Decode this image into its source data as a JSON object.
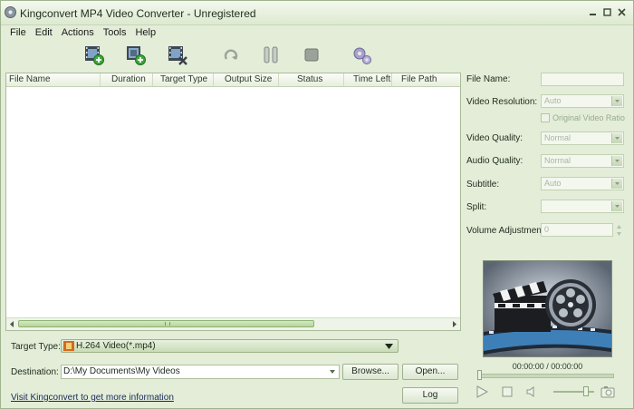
{
  "window": {
    "title": "Kingconvert MP4 Video Converter - Unregistered"
  },
  "menu": [
    {
      "id": "file",
      "label": "File"
    },
    {
      "id": "edit",
      "label": "Edit"
    },
    {
      "id": "actions",
      "label": "Actions"
    },
    {
      "id": "tools",
      "label": "Tools"
    },
    {
      "id": "help",
      "label": "Help"
    }
  ],
  "toolbar": [
    {
      "id": "add-video",
      "icon": "film-add-icon"
    },
    {
      "id": "add-folder",
      "icon": "folder-add-icon"
    },
    {
      "id": "remove",
      "icon": "film-remove-icon"
    },
    {
      "id": "convert",
      "icon": "refresh-icon"
    },
    {
      "id": "pause",
      "icon": "pause-icon"
    },
    {
      "id": "stop",
      "icon": "stop-icon"
    },
    {
      "id": "settings",
      "icon": "gears-icon"
    }
  ],
  "table": {
    "columns": [
      "File Name",
      "Duration",
      "Target Type",
      "Output Size",
      "Status",
      "Time Left",
      "File Path"
    ],
    "rows": []
  },
  "properties": {
    "file_name": {
      "label": "File Name:",
      "value": ""
    },
    "video_resolution": {
      "label": "Video Resolution:",
      "value": "Auto"
    },
    "original_ratio": {
      "label": "Original Video Ratio",
      "checked": false
    },
    "video_quality": {
      "label": "Video Quality:",
      "value": "Normal"
    },
    "audio_quality": {
      "label": "Audio Quality:",
      "value": "Normal"
    },
    "subtitle": {
      "label": "Subtitle:",
      "value": "Auto"
    },
    "split": {
      "label": "Split:",
      "value": ""
    },
    "volume": {
      "label": "Volume Adjustment:",
      "value": "0"
    }
  },
  "player": {
    "timecode": "00:00:00 / 00:00:00",
    "seek_fraction": 0,
    "volume_fraction": 0.8
  },
  "bottom": {
    "target_type_label": "Target Type:",
    "target_type_value": "H.264 Video(*.mp4)",
    "destination_label": "Destination:",
    "destination_value": "D:\\My Documents\\My Videos",
    "browse_label": "Browse...",
    "open_label": "Open...",
    "log_label": "Log",
    "link_text": "Visit Kingconvert to get more information"
  },
  "colors": {
    "accent": "#b6d39c",
    "background": "#e3edd8"
  }
}
